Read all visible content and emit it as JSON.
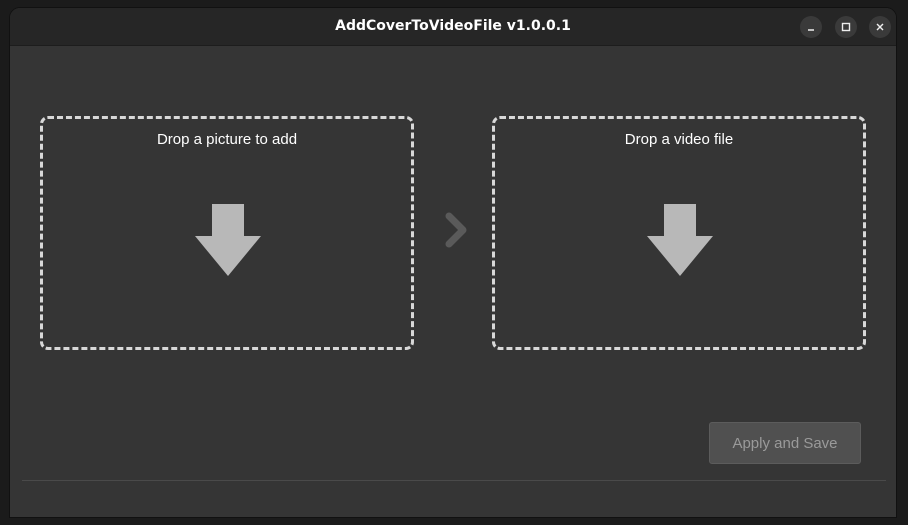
{
  "window": {
    "title": "AddCoverToVideoFile v1.0.0.1",
    "controls": {
      "minimize_icon": "minimize-icon",
      "maximize_icon": "maximize-icon",
      "close_icon": "close-icon"
    }
  },
  "dropzones": {
    "picture": {
      "label": "Drop a picture to add",
      "icon": "arrow-down-icon"
    },
    "video": {
      "label": "Drop a video file",
      "icon": "arrow-down-icon"
    }
  },
  "separator_icon": "chevron-right-icon",
  "actions": {
    "apply_label": "Apply and Save",
    "apply_enabled": false
  },
  "colors": {
    "background": "#353535",
    "titlebar": "#262626",
    "dash_border": "#d8d8d8",
    "arrow": "#b8b8b8",
    "chevron": "#5a5a5a",
    "button_bg": "#505050",
    "button_text": "#9a9a9a"
  }
}
